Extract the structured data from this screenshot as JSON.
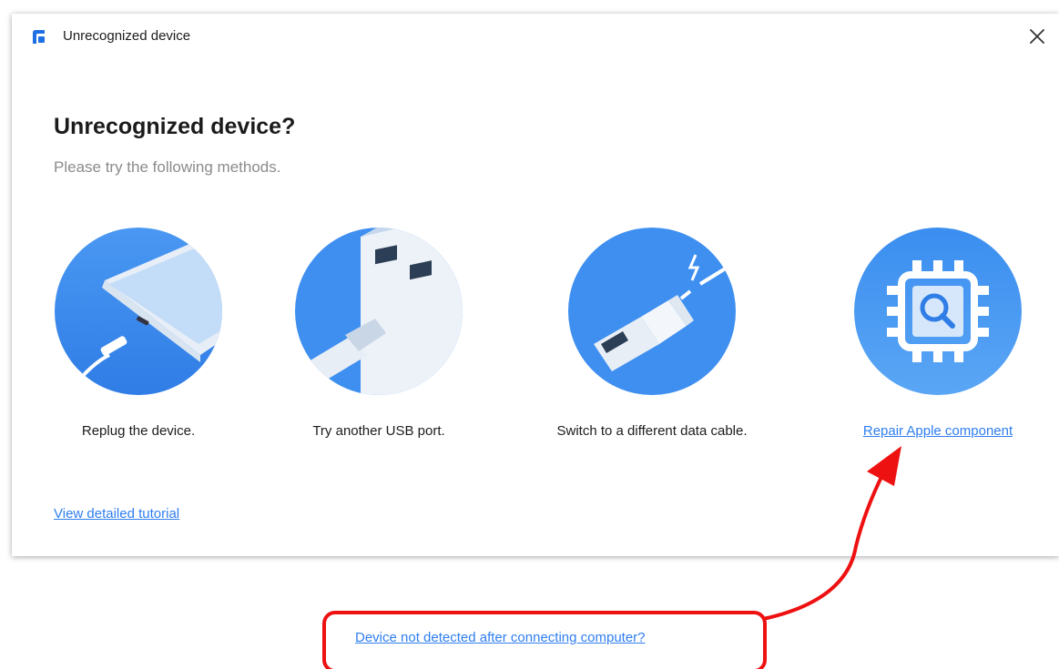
{
  "window": {
    "title": "Unrecognized device",
    "app_icon": "app-logo-icon",
    "close_icon": "close-icon"
  },
  "main": {
    "heading": "Unrecognized device?",
    "subheading": "Please try the following methods."
  },
  "methods": [
    {
      "label": "Replug the device.",
      "icon": "replug-illustration"
    },
    {
      "label": "Try another USB port.",
      "icon": "usb-port-illustration"
    },
    {
      "label": "Switch to a different data cable.",
      "icon": "cable-illustration"
    },
    {
      "label": "Repair Apple component",
      "icon": "repair-component-illustration",
      "is_link": true
    }
  ],
  "links": {
    "tutorial": "View detailed tutorial",
    "not_detected": "Device not detected after connecting computer?"
  },
  "colors": {
    "accent": "#2f7ef0",
    "circle_blue": "#3e8ff0",
    "annotation_red": "#ee1111"
  }
}
